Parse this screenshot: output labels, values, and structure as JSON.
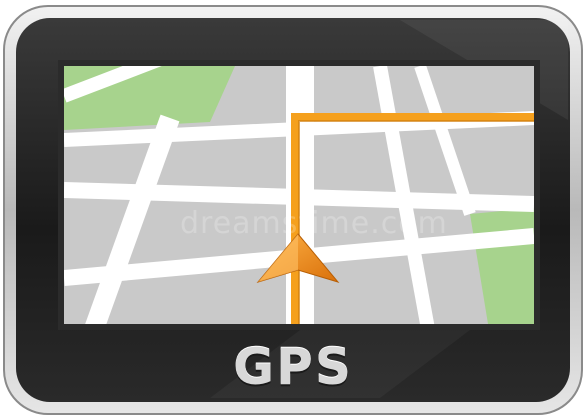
{
  "device": {
    "label": "GPS",
    "label_color": "#d8d8d8",
    "bezel_color": "#1b1b1b",
    "frame_color": "#c4c4c4"
  },
  "map": {
    "road_color": "#ffffff",
    "block_color": "#c9c9c9",
    "park_color": "#a7d38d",
    "route_color": "#f5a01d",
    "direction_arrow": "navigation-arrow-icon"
  },
  "watermark": {
    "text": "dreamstime.com"
  }
}
